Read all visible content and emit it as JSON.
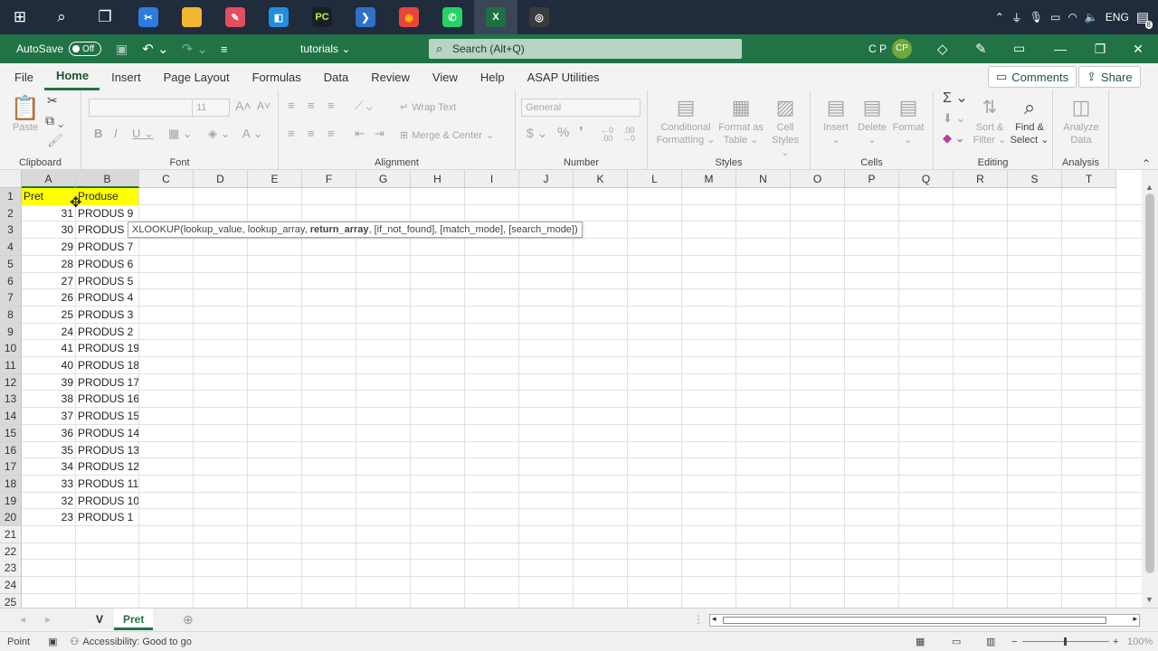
{
  "taskbar": {
    "apps": [
      {
        "name": "windows-start-icon",
        "glyph": "⊞",
        "bg": "",
        "color": "#ffffff"
      },
      {
        "name": "search-icon",
        "glyph": "⌕",
        "bg": "",
        "color": "#ffffff"
      },
      {
        "name": "task-view-icon",
        "glyph": "❐",
        "bg": "",
        "color": "#ffffff"
      },
      {
        "name": "snipping-tool-icon",
        "glyph": "✂",
        "bg": "#2d7be0",
        "color": "#ffffff"
      },
      {
        "name": "file-explorer-icon",
        "glyph": "▆",
        "bg": "#f2b632",
        "color": "#f2b632"
      },
      {
        "name": "paint-icon",
        "glyph": "✎",
        "bg": "#e34d5f",
        "color": "#ffffff"
      },
      {
        "name": "store-icon",
        "glyph": "◧",
        "bg": "#1f8fe0",
        "color": "#ffffff"
      },
      {
        "name": "pycharm-icon",
        "glyph": "PC",
        "bg": "#1b1f23",
        "color": "#b6f34f"
      },
      {
        "name": "powershell-icon",
        "glyph": "❯",
        "bg": "#2e71c9",
        "color": "#ffffff"
      },
      {
        "name": "chrome-icon",
        "glyph": "◉",
        "bg": "#e8453c",
        "color": "#fbbc05"
      },
      {
        "name": "whatsapp-icon",
        "glyph": "✆",
        "bg": "#25d366",
        "color": "#ffffff"
      },
      {
        "name": "excel-icon",
        "glyph": "X",
        "bg": "#1d7044",
        "color": "#ffffff"
      },
      {
        "name": "obs-icon",
        "glyph": "◎",
        "bg": "#3b3b3b",
        "color": "#ffffff"
      }
    ],
    "tray": {
      "lang": "ENG",
      "notif_count": "8"
    }
  },
  "titlebar": {
    "autosave_label": "AutoSave",
    "autosave_state": "Off",
    "filename": "tutorials ⌄",
    "search_placeholder": "Search (Alt+Q)",
    "user_initials": "C P",
    "avatar_text": "CP"
  },
  "menubar": {
    "tabs": [
      "File",
      "Home",
      "Insert",
      "Page Layout",
      "Formulas",
      "Data",
      "Review",
      "View",
      "Help",
      "ASAP Utilities"
    ],
    "active": "Home",
    "comments_label": "Comments",
    "share_label": "Share"
  },
  "ribbon": {
    "groups": {
      "clipboard": "Clipboard",
      "font": "Font",
      "alignment": "Alignment",
      "number": "Number",
      "styles": "Styles",
      "cells": "Cells",
      "editing": "Editing",
      "analysis": "Analysis"
    },
    "paste": "Paste",
    "font_size": "11",
    "wrap_text": "Wrap Text",
    "merge_center": "Merge & Center",
    "number_format": "General",
    "conditional_formatting": [
      "Conditional",
      "Formatting ⌄"
    ],
    "format_as_table": [
      "Format as",
      "Table ⌄"
    ],
    "cell_styles": [
      "Cell",
      "Styles ⌄"
    ],
    "insert": "Insert",
    "delete": "Delete",
    "format": "Format",
    "sort_filter": [
      "Sort &",
      "Filter ⌄"
    ],
    "find_select": [
      "Find &",
      "Select ⌄"
    ],
    "analyze_data": [
      "Analyze",
      "Data"
    ]
  },
  "sheet": {
    "columns": [
      "A",
      "B",
      "C",
      "D",
      "E",
      "F",
      "G",
      "H",
      "I",
      "J",
      "K",
      "L",
      "M",
      "N",
      "O",
      "P",
      "Q",
      "R",
      "S",
      "T"
    ],
    "row_numbers": [
      "1",
      "2",
      "3",
      "4",
      "5",
      "6",
      "7",
      "8",
      "9",
      "10",
      "11",
      "12",
      "13",
      "14",
      "15",
      "16",
      "17",
      "18",
      "19",
      "20",
      "21",
      "22",
      "23",
      "24",
      "25"
    ],
    "header": {
      "a": "Pret",
      "b": "Produse"
    },
    "rows": [
      {
        "a": "31",
        "b": "PRODUS 9"
      },
      {
        "a": "30",
        "b": "PRODUS 8"
      },
      {
        "a": "29",
        "b": "PRODUS 7"
      },
      {
        "a": "28",
        "b": "PRODUS 6"
      },
      {
        "a": "27",
        "b": "PRODUS 5"
      },
      {
        "a": "26",
        "b": "PRODUS 4"
      },
      {
        "a": "25",
        "b": "PRODUS 3"
      },
      {
        "a": "24",
        "b": "PRODUS 2"
      },
      {
        "a": "41",
        "b": "PRODUS 19"
      },
      {
        "a": "40",
        "b": "PRODUS 18"
      },
      {
        "a": "39",
        "b": "PRODUS 17"
      },
      {
        "a": "38",
        "b": "PRODUS 16"
      },
      {
        "a": "37",
        "b": "PRODUS 15"
      },
      {
        "a": "36",
        "b": "PRODUS 14"
      },
      {
        "a": "35",
        "b": "PRODUS 13"
      },
      {
        "a": "34",
        "b": "PRODUS 12"
      },
      {
        "a": "33",
        "b": "PRODUS 11"
      },
      {
        "a": "32",
        "b": "PRODUS 10"
      },
      {
        "a": "23",
        "b": "PRODUS 1"
      }
    ],
    "tooltip": {
      "fn": "XLOOKUP(lookup_value, lookup_array, ",
      "bold": "return_array",
      "rest": ", [if_not_found], [match_mode], [search_mode])"
    },
    "header_fill": "#ffff00"
  },
  "sheet_tabs": [
    "V",
    "Pret"
  ],
  "statusbar": {
    "mode": "Point",
    "accessibility": "Accessibility: Good to go",
    "zoom": "100%"
  }
}
